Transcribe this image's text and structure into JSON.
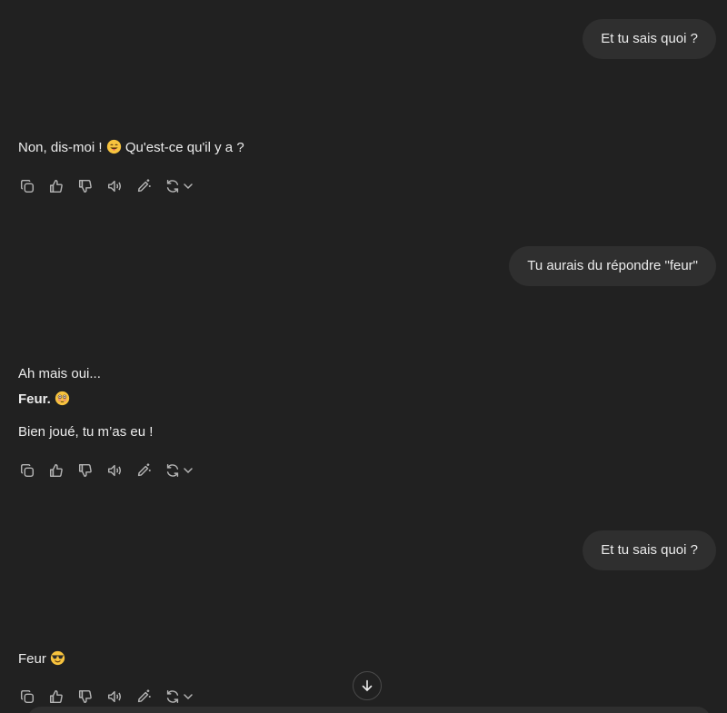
{
  "messages": [
    {
      "role": "user",
      "text": "Et tu sais quoi ?"
    },
    {
      "role": "assistant",
      "text_before": "Non, dis-moi ! ",
      "emoji": "grinning-face-with-tongue",
      "text_after": " Qu'est-ce qu'il y a ?"
    },
    {
      "role": "user",
      "text": "Tu aurais du répondre \"feur\""
    },
    {
      "role": "assistant",
      "line1": "Ah mais oui...",
      "line2_bold": "Feur.",
      "line2_emoji": "flushed-face",
      "line3": "Bien joué, tu m’as eu !"
    },
    {
      "role": "user",
      "text": "Et tu sais quoi ?"
    },
    {
      "role": "assistant",
      "text": "Feur",
      "emoji": "smiling-face-with-sunglasses"
    }
  ],
  "action_icons": [
    "copy-icon",
    "thumbs-up-icon",
    "thumbs-down-icon",
    "read-aloud-icon",
    "edit-sparkle-icon",
    "regenerate-icon",
    "chevron-down-icon"
  ],
  "colors": {
    "background": "#212121",
    "bubble": "#2f2f2f",
    "text": "#ececec",
    "icon": "#b4b4b4"
  }
}
